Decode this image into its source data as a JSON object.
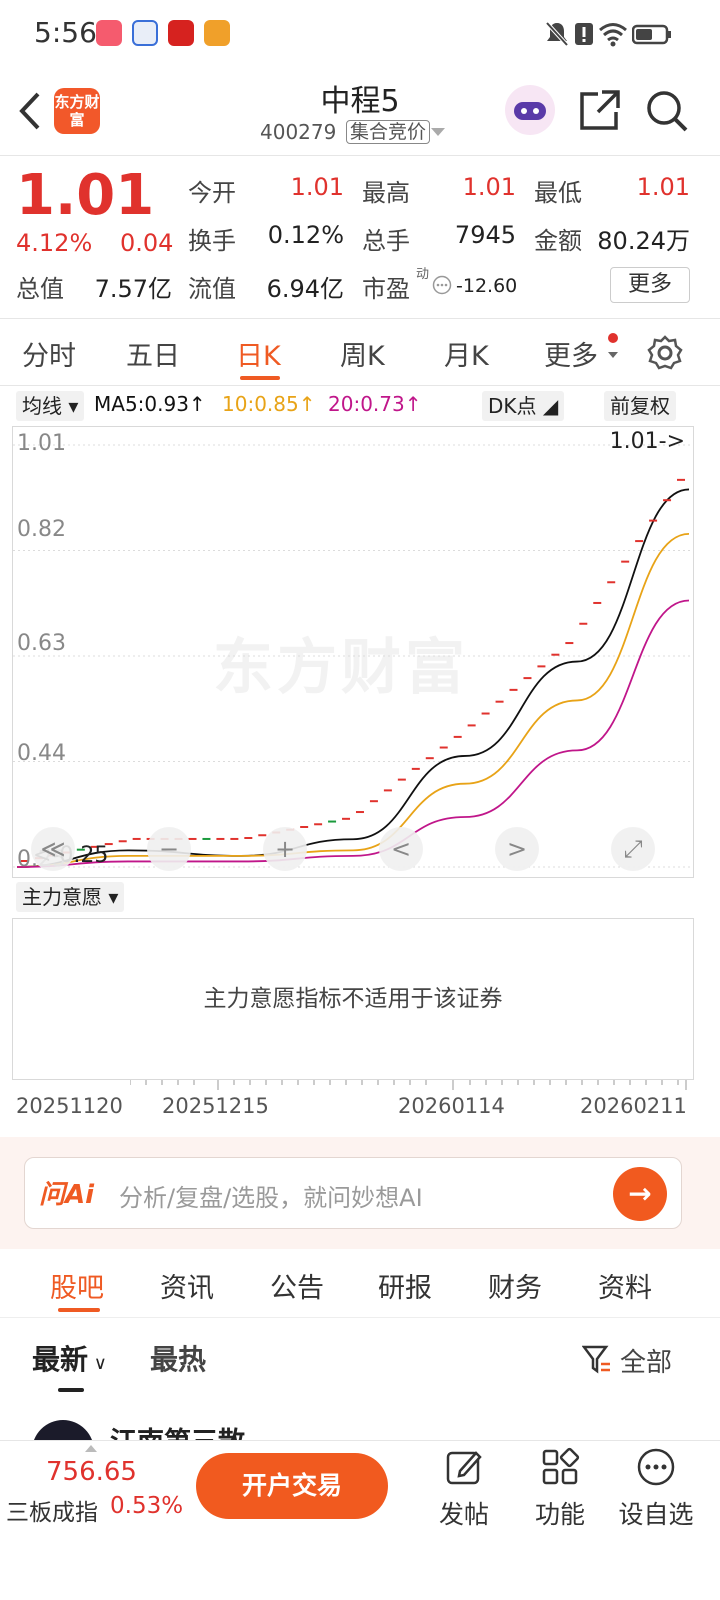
{
  "status_bar": {
    "time": "5:56"
  },
  "header": {
    "logo_text": "东方财富",
    "stock_name": "中程5",
    "stock_code": "400279",
    "auction_tag": "集合竞价"
  },
  "quote": {
    "price": "1.01",
    "change_pct": "4.12%",
    "change": "0.04",
    "fields": {
      "open_label": "今开",
      "open": "1.01",
      "high_label": "最高",
      "high": "1.01",
      "low_label": "最低",
      "low": "1.01",
      "turnover_label": "换手",
      "turnover": "0.12%",
      "volume_label": "总手",
      "volume": "7945",
      "amount_label": "金额",
      "amount": "80.24万",
      "total_value_label": "总值",
      "total_value": "7.57亿",
      "float_value_label": "流值",
      "float_value": "6.94亿",
      "pe_label": "市盈",
      "pe_super": "动",
      "pe": "-12.60"
    },
    "more_button": "更多"
  },
  "period_tabs": [
    "分时",
    "五日",
    "日K",
    "周K",
    "月K",
    "更多"
  ],
  "ma_row": {
    "selector": "均线",
    "ma5": "MA5:0.93↑",
    "ma10": "10:0.85↑",
    "ma20": "20:0.73↑",
    "dk": "DK点",
    "adjust": "前复权"
  },
  "chart": {
    "y_labels": [
      "1.01",
      "0.82",
      "0.63",
      "0.44",
      "0.25"
    ],
    "latest_marker": "1.01->",
    "low_marker": "<-0.25",
    "watermark": "东方财富",
    "controls": [
      "≪",
      "−",
      "+",
      "<",
      ">",
      "⤢"
    ]
  },
  "chart_data": {
    "type": "line",
    "x": [
      "20251120",
      "20251215",
      "20260114",
      "20260211"
    ],
    "ylim": [
      0.25,
      1.01
    ],
    "series": [
      {
        "name": "MA5",
        "color": "#111111",
        "values": [
          0.25,
          0.28,
          0.27,
          0.3,
          0.45,
          0.62,
          0.93
        ]
      },
      {
        "name": "MA10",
        "color": "#e8a317",
        "values": [
          0.25,
          0.27,
          0.27,
          0.28,
          0.4,
          0.55,
          0.85
        ]
      },
      {
        "name": "MA20",
        "color": "#c0168a",
        "values": [
          0.25,
          0.26,
          0.26,
          0.27,
          0.34,
          0.46,
          0.73
        ]
      }
    ]
  },
  "indicator": {
    "selector": "主力意愿",
    "message": "主力意愿指标不适用于该证券"
  },
  "dates": [
    "20251120",
    "20251215",
    "20260114",
    "20260211"
  ],
  "ai_bar": {
    "logo": "问Ai",
    "placeholder": "分析/复盘/选股，就问妙想AI"
  },
  "content_tabs": [
    "股吧",
    "资讯",
    "公告",
    "研报",
    "财务",
    "资料"
  ],
  "filter": {
    "latest": "最新",
    "hot": "最热",
    "all": "全部"
  },
  "post": {
    "author": "江南第三散"
  },
  "bottom_bar": {
    "index_value": "756.65",
    "index_name": "三板成指",
    "index_change": "0.53%",
    "trade_button": "开户交易",
    "items": [
      "发帖",
      "功能",
      "设自选"
    ]
  }
}
